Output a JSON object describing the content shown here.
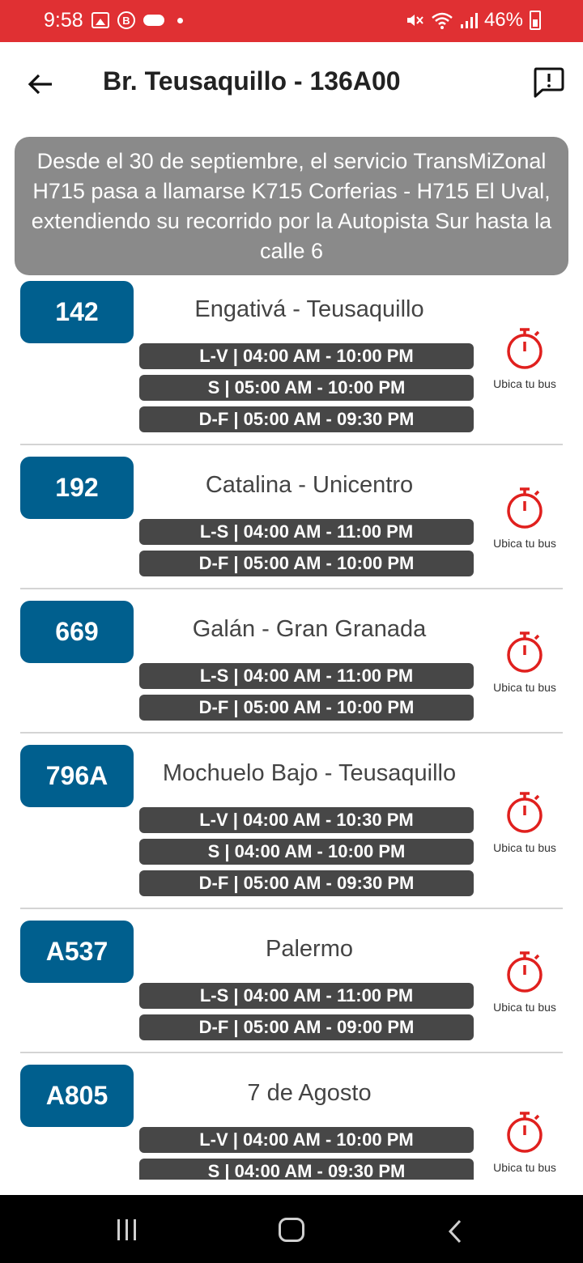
{
  "status_bar": {
    "time": "9:58",
    "battery": "46%"
  },
  "header": {
    "title": "Br. Teusaquillo - 136A00"
  },
  "banner": {
    "text": "Desde el 30 de septiembre, el servicio TransMiZonal H715 pasa a llamarse K715 Corferias - H715 El Uval, extendiendo su recorrido por la Autopista Sur hasta la calle 6"
  },
  "locate_label": "Ubica tu bus",
  "routes": [
    {
      "code": "142",
      "name": "Engativá - Teusaquillo",
      "schedules": [
        "L-V | 04:00 AM - 10:00 PM",
        "S | 05:00 AM - 10:00 PM",
        "D-F | 05:00 AM - 09:30 PM"
      ]
    },
    {
      "code": "192",
      "name": "Catalina - Unicentro",
      "schedules": [
        "L-S | 04:00 AM - 11:00 PM",
        "D-F | 05:00 AM - 10:00 PM"
      ]
    },
    {
      "code": "669",
      "name": "Galán - Gran Granada",
      "schedules": [
        "L-S | 04:00 AM - 11:00 PM",
        "D-F | 05:00 AM - 10:00 PM"
      ]
    },
    {
      "code": "796A",
      "name": "Mochuelo Bajo - Teusaquillo",
      "schedules": [
        "L-V | 04:00 AM - 10:30 PM",
        "S | 04:00 AM - 10:00 PM",
        "D-F | 05:00 AM - 09:30 PM"
      ]
    },
    {
      "code": "A537",
      "name": "Palermo",
      "schedules": [
        "L-S | 04:00 AM - 11:00 PM",
        "D-F | 05:00 AM - 09:00 PM"
      ]
    },
    {
      "code": "A805",
      "name": "7 de Agosto",
      "schedules": [
        "L-V | 04:00 AM - 10:00 PM",
        "S | 04:00 AM - 09:30 PM"
      ]
    }
  ],
  "colors": {
    "status_bar": "#e03033",
    "route_badge": "#005f8e",
    "schedule_pill": "#474747",
    "banner": "#8a8a8a",
    "stopwatch": "#e0201e"
  }
}
